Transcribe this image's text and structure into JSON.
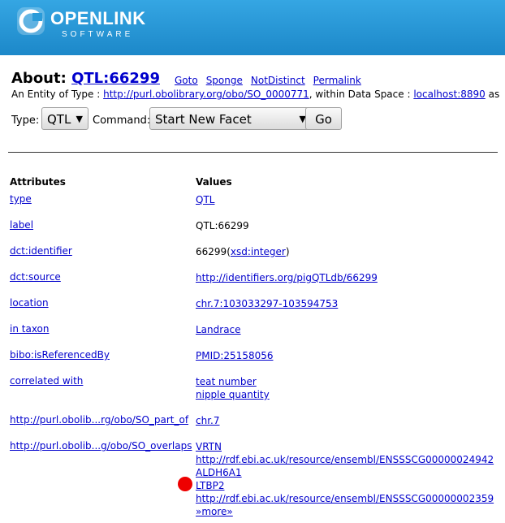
{
  "brand": {
    "name": "OPENLINK",
    "sub": "SOFTWARE",
    "colors": {
      "header": "#1d8fd0",
      "link": "#0000cc"
    }
  },
  "about": {
    "prefix": "About:",
    "title": "QTL:66299",
    "links": [
      "Goto",
      "Sponge",
      "NotDistinct",
      "Permalink"
    ]
  },
  "entity": {
    "prefix": "An Entity of Type :",
    "type_url": "http://purl.obolibrary.org/obo/SO_0000771",
    "middle": ", within Data Space :",
    "space": "localhost:8890",
    "suffix": "as"
  },
  "controls": {
    "type_label": "Type:",
    "type_value": "QTL",
    "command_label": "Command:",
    "command_value": "Start New Facet",
    "go_label": "Go"
  },
  "table": {
    "attr_header": "Attributes",
    "values_header": "Values",
    "rows": [
      {
        "attr": "type",
        "values": [
          {
            "text": "QTL",
            "link": true
          }
        ]
      },
      {
        "attr": "label",
        "values": [
          {
            "text": "QTL:66299",
            "link": false
          }
        ]
      },
      {
        "attr": "dct:identifier",
        "values": [
          {
            "text": "66299",
            "link": false,
            "dtype": "xsd:integer"
          }
        ]
      },
      {
        "attr": "dct:source",
        "values": [
          {
            "text": "http://identifiers.org/pigQTLdb/66299",
            "link": true
          }
        ]
      },
      {
        "attr": "location",
        "values": [
          {
            "text": "chr.7:103033297-103594753",
            "link": true
          }
        ]
      },
      {
        "attr": "in taxon",
        "values": [
          {
            "text": "Landrace",
            "link": true
          }
        ]
      },
      {
        "attr": "bibo:isReferencedBy",
        "values": [
          {
            "text": "PMID:25158056",
            "link": true
          }
        ]
      },
      {
        "attr": "correlated with",
        "values": [
          {
            "text": "teat number",
            "link": true
          },
          {
            "text": "nipple quantity",
            "link": true
          }
        ]
      },
      {
        "attr": "http://purl.obolib...rg/obo/SO_part_of",
        "values": [
          {
            "text": "chr.7",
            "link": true
          }
        ]
      },
      {
        "attr": "http://purl.obolib...g/obo/SO_overlaps",
        "values": [
          {
            "text": "VRTN",
            "link": true
          },
          {
            "text": "http://rdf.ebi.ac.uk/resource/ensembl/ENSSSCG00000024942",
            "link": true
          },
          {
            "text": "ALDH6A1",
            "link": true
          },
          {
            "text": "LTBP2",
            "link": true
          },
          {
            "text": "http://rdf.ebi.ac.uk/resource/ensembl/ENSSSCG00000002359",
            "link": true
          },
          {
            "text": "»more»",
            "link": true
          }
        ]
      }
    ]
  }
}
